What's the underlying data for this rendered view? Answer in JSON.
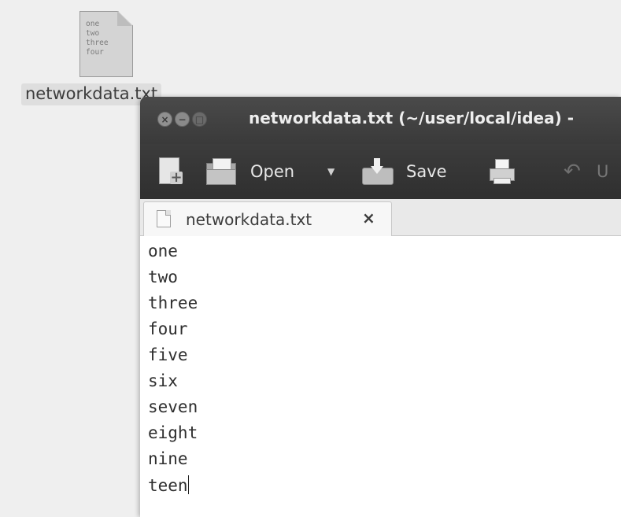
{
  "desktop": {
    "file": {
      "name": "networkdata.txt",
      "icon": "text-file-icon",
      "preview_lines": [
        "one",
        "two",
        "three",
        "four"
      ]
    }
  },
  "window": {
    "title": "networkdata.txt (~/user/local/idea) -",
    "controls": [
      "close-icon",
      "minimize-icon",
      "maximize-icon"
    ],
    "toolbar": {
      "new_icon": "new-document-icon",
      "open_label": "Open",
      "dropdown_icon": "dropdown-arrow-icon",
      "save_label": "Save",
      "print_icon": "print-icon",
      "undo_label": "U"
    },
    "tab": {
      "label": "networkdata.txt",
      "close_glyph": "×"
    },
    "editor": {
      "lines": [
        "one",
        "two",
        "three",
        "four",
        "five",
        "six",
        "seven",
        "eight",
        "nine",
        "teen"
      ]
    }
  },
  "colors": {
    "titlebar": "#3a3a3a",
    "desktop": "#efefef",
    "editor_bg": "#ffffff"
  }
}
